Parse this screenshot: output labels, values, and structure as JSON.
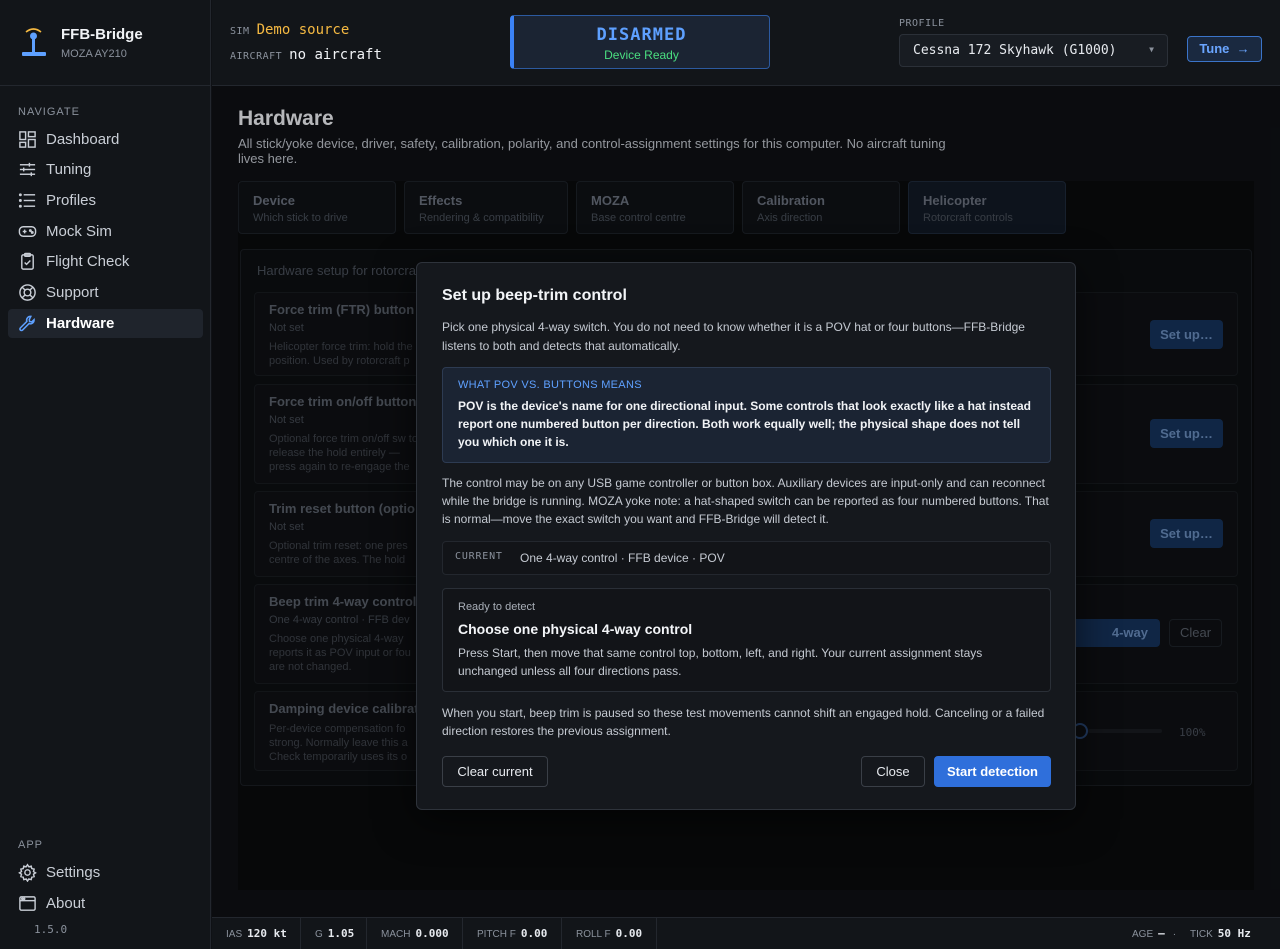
{
  "brand": {
    "name": "FFB-Bridge",
    "device": "MOZA AY210"
  },
  "nav": {
    "section_label": "NAVIGATE",
    "items": [
      {
        "label": "Dashboard",
        "icon": "dashboard-icon"
      },
      {
        "label": "Tuning",
        "icon": "sliders-icon"
      },
      {
        "label": "Profiles",
        "icon": "list-icon"
      },
      {
        "label": "Mock Sim",
        "icon": "gamepad-icon"
      },
      {
        "label": "Flight Check",
        "icon": "clipboard-check-icon"
      },
      {
        "label": "Support",
        "icon": "lifebuoy-icon"
      },
      {
        "label": "Hardware",
        "icon": "wrench-icon",
        "active": true
      }
    ],
    "app_label": "APP",
    "app_items": [
      {
        "label": "Settings",
        "icon": "gear-icon"
      },
      {
        "label": "About",
        "icon": "window-icon"
      }
    ],
    "version": "1.5.0"
  },
  "topbar": {
    "sim_label": "SIM",
    "sim_value": "Demo source",
    "aircraft_label": "AIRCRAFT",
    "aircraft_value": "no aircraft",
    "arm_state": "DISARMED",
    "device_status": "Device Ready",
    "profile_label": "PROFILE",
    "profile_value": "Cessna 172 Skyhawk (G1000)",
    "tune_label": "Tune"
  },
  "page": {
    "title": "Hardware",
    "description": "All stick/yoke device, driver, safety, calibration, polarity, and control-assignment settings for this computer. No aircraft tuning lives here.",
    "tabs": [
      {
        "title": "Device",
        "sub": "Which stick to drive"
      },
      {
        "title": "Effects",
        "sub": "Rendering & compatibility"
      },
      {
        "title": "MOZA",
        "sub": "Base control centre"
      },
      {
        "title": "Calibration",
        "sub": "Axis direction"
      },
      {
        "title": "Helicopter",
        "sub": "Rotorcraft controls"
      }
    ],
    "panel_heading": "Hardware setup for rotorcraft",
    "rows": [
      {
        "title": "Force trim (FTR) button",
        "status": "Not set",
        "desc": "Helicopter force trim: hold the position. Used by rotorcraft p"
      },
      {
        "title": "Force trim on/off button",
        "status": "Not set",
        "desc": "Optional force trim on/off sw to release the hold entirely — press again to re-engage the"
      },
      {
        "title": "Trim reset button (optio",
        "status": "Not set",
        "desc": "Optional trim reset: one pres centre of the axes. The hold"
      },
      {
        "title": "Beep trim 4-way control",
        "status": "One 4-way control · FFB dev",
        "desc": "Choose one physical 4-way reports it as POV input or fou are not changed."
      },
      {
        "title": "Damping device calibrati",
        "status": "",
        "desc": "Per-device compensation fo strong. Normally leave this a Check temporarily uses its o"
      }
    ],
    "setup_label": "Set up…",
    "assign_label": "4-way control…",
    "clear_label": "Clear",
    "slider_value": "100%"
  },
  "modal": {
    "title": "Set up beep-trim control",
    "intro": "Pick one physical 4-way switch. You do not need to know whether it is a POV hat or four buttons—FFB-Bridge listens to both and detects that automatically.",
    "info_heading": "WHAT POV VS. BUTTONS MEANS",
    "info_body": "POV is the device's name for one directional input. Some controls that look exactly like a hat instead report one numbered button per direction. Both work equally well; the physical shape does not tell you which one it is.",
    "note": "The control may be on any USB game controller or button box. Auxiliary devices are input-only and can reconnect while the bridge is running. MOZA yoke note: a hat-shaped switch can be reported as four numbered buttons. That is normal—move the exact switch you want and FFB-Bridge will detect it.",
    "current_label": "CURRENT",
    "current_value": "One 4-way control · FFB device · POV",
    "detect_status": "Ready to detect",
    "detect_title": "Choose one physical 4-way control",
    "detect_desc": "Press Start, then move that same control top, bottom, left, and right. Your current assignment stays unchanged unless all four directions pass.",
    "footer": "When you start, beep trim is paused so these test movements cannot shift an engaged hold. Canceling or a failed direction restores the previous assignment.",
    "clear_current_label": "Clear current",
    "close_label": "Close",
    "start_label": "Start detection"
  },
  "statusbar": {
    "ias_label": "IAS",
    "ias_value": "120 kt",
    "g_label": "G",
    "g_value": "1.05",
    "mach_label": "MACH",
    "mach_value": "0.000",
    "pitch_label": "PITCH F",
    "pitch_value": "0.00",
    "roll_label": "ROLL F",
    "roll_value": "0.00",
    "age_label": "AGE",
    "age_value": "—",
    "tick_label": "TICK",
    "tick_value": "50 Hz"
  },
  "colors": {
    "accent": "#3b82f6",
    "ready": "#4ade80",
    "sim_source": "#f5b942"
  }
}
